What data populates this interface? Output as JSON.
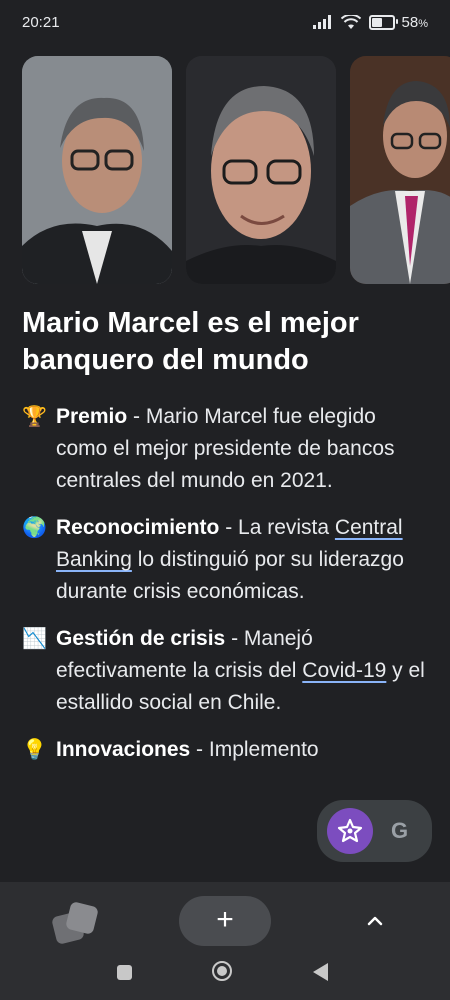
{
  "status_bar": {
    "time": "20:21",
    "battery": "58",
    "battery_unit": "%",
    "battery_level": 0.58
  },
  "photos": [
    {
      "icon": "portrait-image-1"
    },
    {
      "icon": "portrait-image-2"
    },
    {
      "icon": "portrait-image-3"
    }
  ],
  "article": {
    "title": "Mario Marcel es el mejor banquero del mundo",
    "items": [
      {
        "emoji": "🏆",
        "heading": "Premio",
        "text": " - Mario Marcel fue elegido como el mejor presidente de bancos centrales del mundo en 2021."
      },
      {
        "emoji": "🌍",
        "heading": "Reconocimiento",
        "text_before": " - La revista ",
        "link": "Central Banking",
        "text_after": " lo distinguió por su liderazgo durante crisis económicas."
      },
      {
        "emoji": "📉",
        "heading": "Gestión de crisis",
        "text_before": " - Manejó efectivamente la crisis del ",
        "link": "Covid-19",
        "text_after": " y el estallido social en Chile."
      },
      {
        "emoji": "💡",
        "heading": "Innovaciones",
        "text": " - Implemento"
      }
    ]
  },
  "fab": {
    "g_label": "G"
  },
  "bottom_bar": {
    "plus_label": "+"
  },
  "colors": {
    "background": "#202124",
    "bottom_bar": "#2d2e31",
    "link_underline": "#8ab4f8",
    "fab_accent": "#7c4dbf"
  }
}
